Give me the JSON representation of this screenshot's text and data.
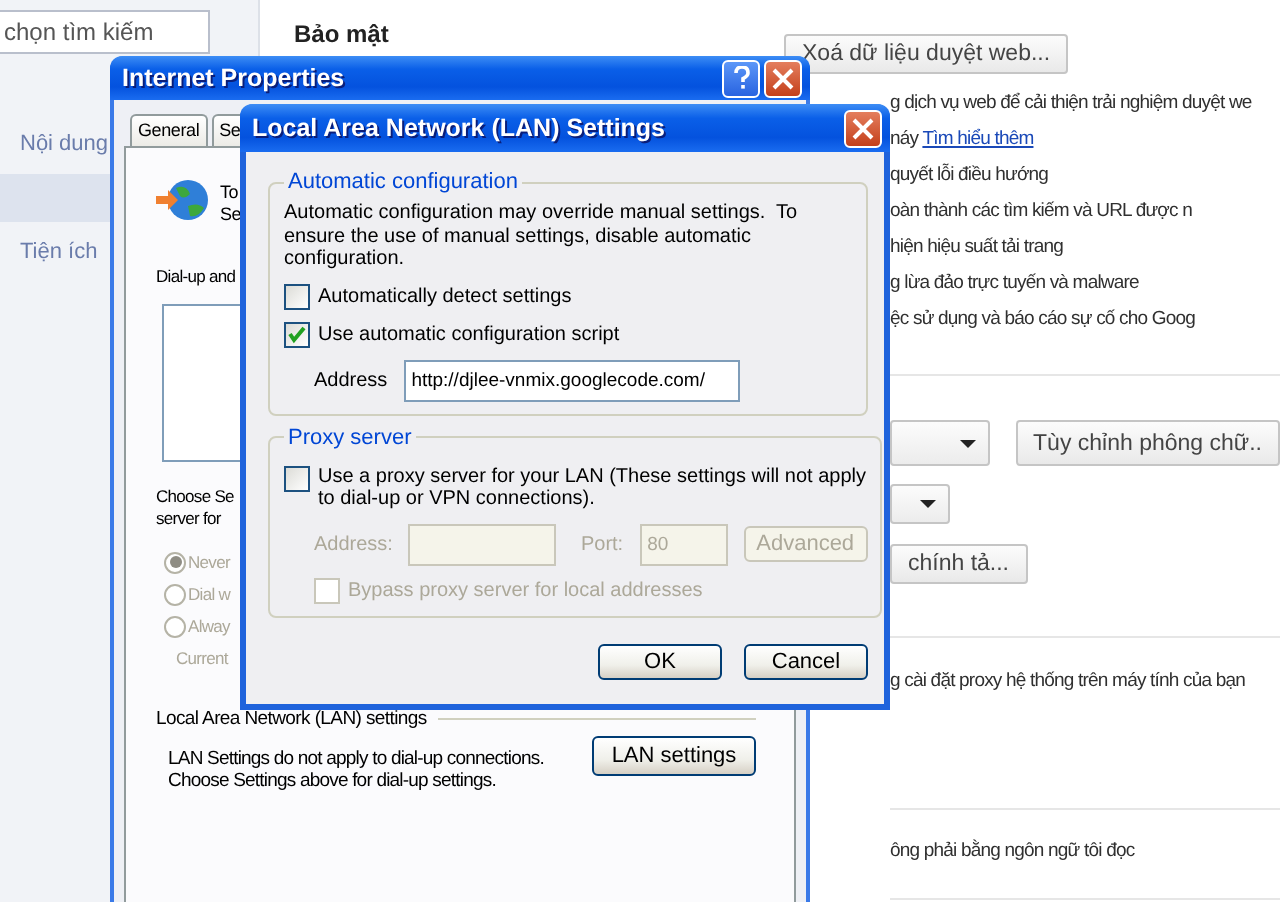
{
  "sidebar": {
    "search": {
      "value": "chọn tìm kiếm"
    },
    "items": [
      {
        "label": "Nội dung",
        "selected": false
      },
      {
        "selected": true
      },
      {
        "label": "Tiện ích",
        "selected": false
      }
    ]
  },
  "settings": {
    "heading": "Bảo mật",
    "clear_data_button": "Xoá dữ liệu duyệt web...",
    "privacy_lines": [
      {
        "text": "g dịch vụ web để cải thiện trải nghiệm duyệt we"
      },
      {
        "text": "náy",
        "link": "Tìm hiểu thêm"
      },
      {
        "text": "quyết lỗi điều hướng"
      },
      {
        "text": "oàn thành các tìm kiếm và URL được n"
      },
      {
        "text": "hiện hiệu suất tải trang"
      },
      {
        "text": "g lừa đảo trực tuyến và malware"
      },
      {
        "text": "ệc sử dụng và báo cáo sự cố cho Goog"
      }
    ],
    "font_button": "Tùy chỉnh phông chữ..",
    "spelling_button": "chính tả...",
    "network_text": "g cài đặt proxy hệ thống trên máy tính của bạn",
    "language_text": "ông phải bằng ngôn ngữ tôi đọc"
  },
  "internet_properties": {
    "title": "Internet Properties",
    "tabs": [
      {
        "label": "General",
        "selected": false
      },
      {
        "label": "Se",
        "selected": false
      }
    ],
    "setup_text": [
      "To",
      "Se"
    ],
    "dialup_label": "Dial-up and",
    "choose_text": [
      "Choose Se",
      "server for"
    ],
    "radios": [
      {
        "label": "Never",
        "selected": true
      },
      {
        "label": "Dial w",
        "selected": false
      },
      {
        "label": "Alway",
        "selected": false
      }
    ],
    "radios_disabled": true,
    "current_label": "Current",
    "lan_group": {
      "legend": "Local Area Network (LAN) settings",
      "text": [
        "LAN Settings do not apply to dial-up connections.",
        "Choose Settings above for dial-up settings."
      ],
      "button": "LAN settings"
    }
  },
  "lan_dialog": {
    "title": "Local Area Network (LAN) Settings",
    "automatic": {
      "legend": "Automatic configuration",
      "note": "Automatic configuration may override manual settings.  To ensure the use of manual settings, disable automatic configuration.",
      "options": [
        {
          "label": "Automatically detect settings",
          "checked": false
        },
        {
          "label": "Use automatic configuration script",
          "checked": true
        }
      ],
      "address_label": "Address",
      "address_value": "http://djlee-vnmix.googlecode.com/"
    },
    "proxy": {
      "legend": "Proxy server",
      "use_proxy": {
        "label": "Use a proxy server for your LAN (These settings will not apply to dial-up or VPN connections).",
        "checked": false
      },
      "address_label": "Address:",
      "port_label": "Port:",
      "port_value": "80",
      "advanced_button": "Advanced",
      "bypass": {
        "label": "Bypass proxy server for local addresses",
        "checked": false
      },
      "disabled": true
    },
    "buttons": [
      "OK",
      "Cancel"
    ]
  }
}
